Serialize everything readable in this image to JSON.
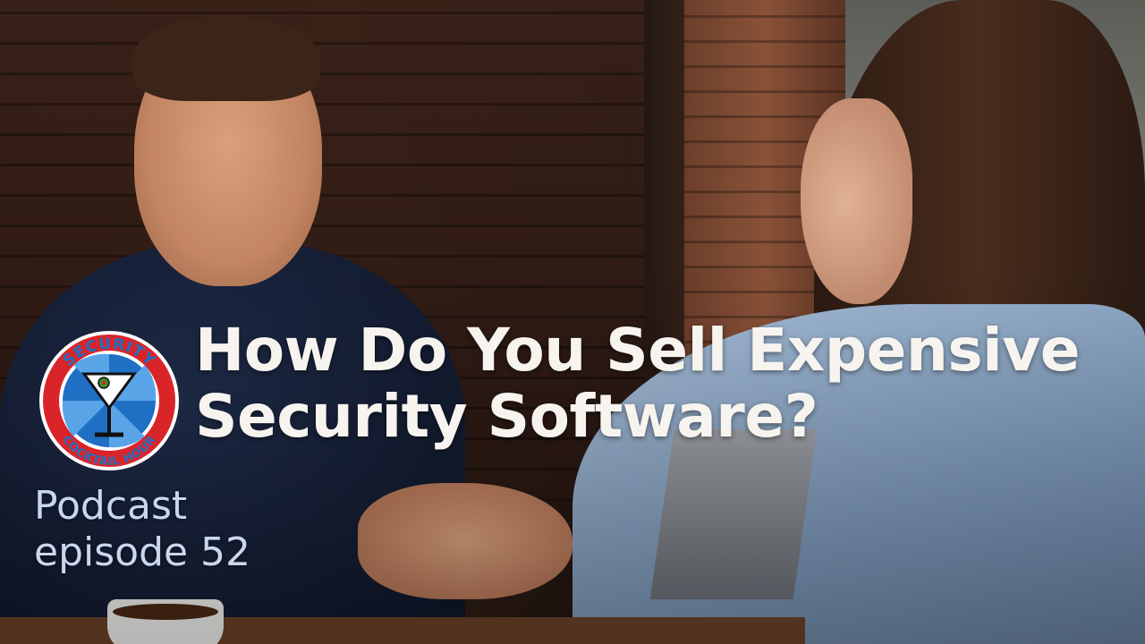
{
  "title": {
    "line1": "How Do You Sell Expensive",
    "line2": "Security Software?"
  },
  "caption": {
    "line1": "Podcast",
    "line2": "episode 52"
  },
  "logo": {
    "top_text": "SECURITY",
    "bottom_text": "COCKTAIL HOUR",
    "icon": "martini-glass-icon"
  },
  "colors": {
    "title": "#f7f4ef",
    "caption": "#c9d6ee",
    "logo_red": "#d9252a",
    "logo_blue": "#1f6fc4"
  }
}
